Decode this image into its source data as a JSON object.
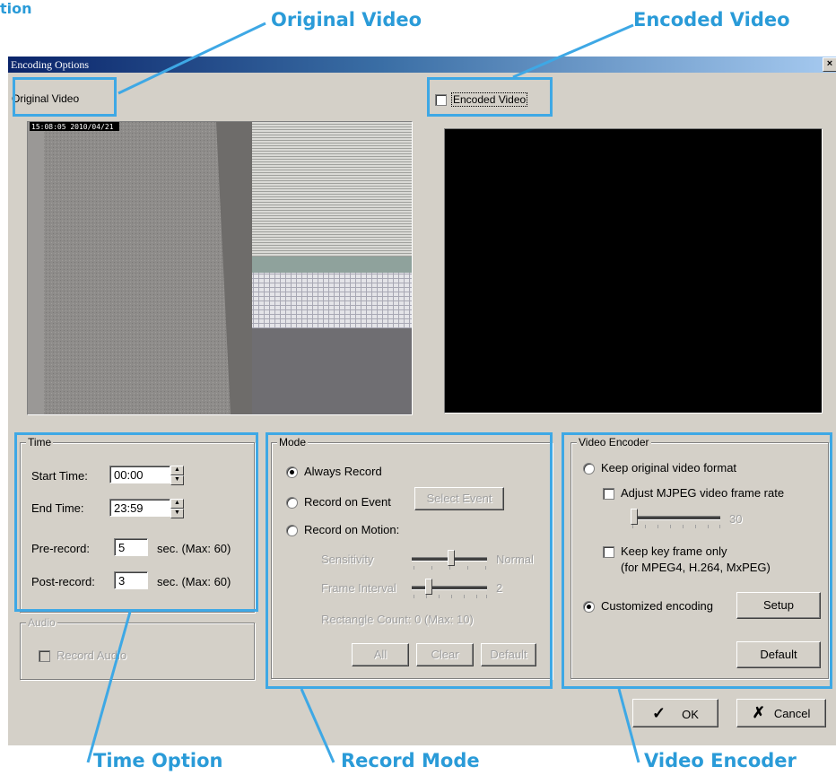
{
  "callouts": {
    "top_left_fragment": "tion",
    "original_video": "Original Video",
    "encoded_video": "Encoded Video",
    "time_option": "Time Option",
    "record_mode": "Record Mode",
    "video_encoder": "Video Encoder"
  },
  "window": {
    "title": "Encoding Options",
    "close_glyph": "×"
  },
  "original_video": {
    "label": "Original Video",
    "timestamp": "15:08:05 2010/04/21"
  },
  "encoded_video": {
    "label": "Encoded Video",
    "checked": false
  },
  "time": {
    "group_label": "Time",
    "start_label": "Start Time:",
    "start_value": "00:00",
    "end_label": "End Time:",
    "end_value": "23:59",
    "pre_label": "Pre-record:",
    "pre_value": "5",
    "pre_unit": "sec. (Max: 60)",
    "post_label": "Post-record:",
    "post_value": "3",
    "post_unit": "sec. (Max: 60)"
  },
  "audio": {
    "group_label": "Audio",
    "record_audio": "Record Audio"
  },
  "mode": {
    "group_label": "Mode",
    "always_record": "Always Record",
    "record_on_event": "Record on Event",
    "select_event": "Select Event",
    "record_on_motion": "Record on Motion:",
    "sensitivity": "Sensitivity",
    "sensitivity_value": "Normal",
    "frame_interval": "Frame Interval",
    "frame_interval_value": "2",
    "rectangle_count": "Rectangle Count: 0  (Max: 10)",
    "all": "All",
    "clear": "Clear",
    "default": "Default",
    "selected": "always_record"
  },
  "encoder": {
    "group_label": "Video Encoder",
    "keep_original": "Keep original video format",
    "adjust_mjpeg": "Adjust MJPEG video frame rate",
    "frame_rate_value": "30",
    "keep_key_frame": "Keep key frame only",
    "keep_key_frame_note": "(for MPEG4, H.264, MxPEG)",
    "customized": "Customized encoding",
    "setup": "Setup",
    "default": "Default",
    "selected": "customized"
  },
  "footer": {
    "ok": "OK",
    "ok_glyph": "✓",
    "cancel": "Cancel",
    "cancel_glyph": "✗"
  },
  "colors": {
    "callout": "#2a9bd8",
    "dialog_face": "#d4d0c8",
    "title_bar_start": "#0a246a"
  }
}
